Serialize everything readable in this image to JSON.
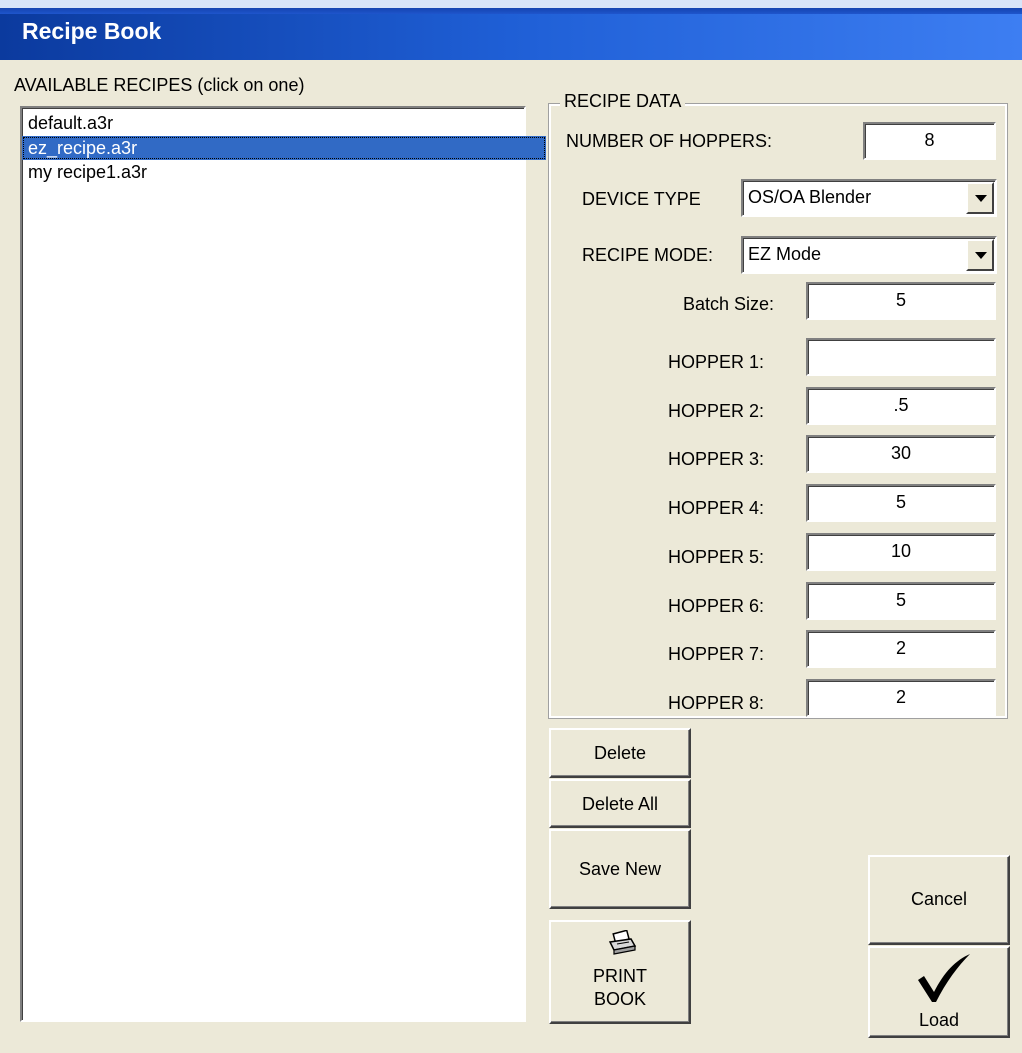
{
  "window": {
    "title": "Recipe Book"
  },
  "recipes": {
    "header": "AVAILABLE RECIPES (click on one)",
    "items": [
      "default.a3r",
      "ez_recipe.a3r",
      "my recipe1.a3r"
    ],
    "selected_index": 1
  },
  "recipe_data": {
    "group_title": "RECIPE DATA",
    "num_hoppers_label": "NUMBER OF HOPPERS:",
    "num_hoppers_value": "8",
    "device_type_label": "DEVICE TYPE",
    "device_type_value": "OS/OA Blender",
    "recipe_mode_label": "RECIPE MODE:",
    "recipe_mode_value": "EZ Mode",
    "batch_size_label": "Batch Size:",
    "batch_size_value": "5",
    "hoppers": [
      {
        "label": "HOPPER 1:",
        "value": ""
      },
      {
        "label": "HOPPER 2:",
        "value": ".5"
      },
      {
        "label": "HOPPER 3:",
        "value": "30"
      },
      {
        "label": "HOPPER 4:",
        "value": "5"
      },
      {
        "label": "HOPPER 5:",
        "value": "10"
      },
      {
        "label": "HOPPER 6:",
        "value": "5"
      },
      {
        "label": "HOPPER 7:",
        "value": "2"
      },
      {
        "label": "HOPPER 8:",
        "value": "2"
      }
    ]
  },
  "buttons": {
    "delete": "Delete",
    "delete_all": "Delete All",
    "save_new": "Save New",
    "print_line1": "PRINT",
    "print_line2": "BOOK",
    "cancel": "Cancel",
    "load": "Load"
  },
  "icons": {
    "print": "printer-icon",
    "load": "checkmark-icon"
  }
}
